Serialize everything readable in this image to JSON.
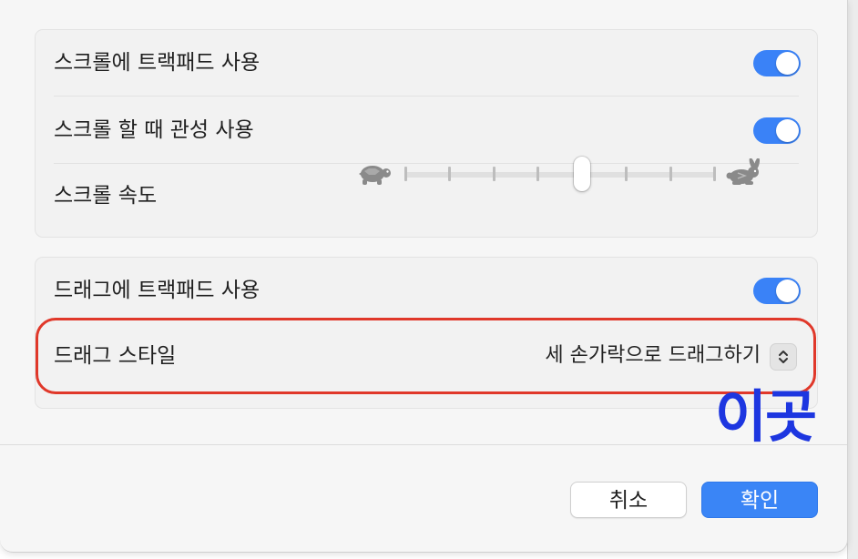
{
  "scroll_group": {
    "trackpad_scroll_label": "스크롤에 트랙패드 사용",
    "trackpad_scroll_on": true,
    "inertia_label": "스크롤 할 때 관성 사용",
    "inertia_on": true,
    "speed_label": "스크롤 속도",
    "speed_slider": {
      "tick_count": 8,
      "selected_index": 4,
      "min_icon": "turtle-icon",
      "max_icon": "rabbit-icon"
    }
  },
  "drag_group": {
    "trackpad_drag_label": "드래그에 트랙패드 사용",
    "trackpad_drag_on": true,
    "drag_style_label": "드래그 스타일",
    "drag_style_value": "세 손가락으로 드래그하기"
  },
  "annotation": {
    "text": "이곳",
    "color": "#1d36e0",
    "highlight_color": "#e0382a"
  },
  "buttons": {
    "cancel": "취소",
    "ok": "확인"
  },
  "colors": {
    "accent": "#3a82f7"
  }
}
